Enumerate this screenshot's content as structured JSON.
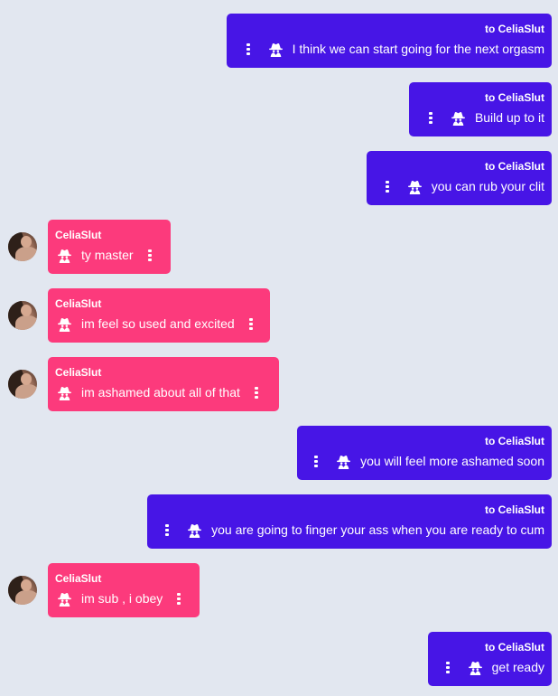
{
  "conversation": {
    "partner": "CeliaSlut",
    "messages": [
      {
        "direction": "outgoing",
        "meta": "to CeliaSlut",
        "text": "I think we can start going for the next orgasm"
      },
      {
        "direction": "outgoing",
        "meta": "to CeliaSlut",
        "text": "Build up to it"
      },
      {
        "direction": "outgoing",
        "meta": "to CeliaSlut",
        "text": "you can rub your clit"
      },
      {
        "direction": "incoming",
        "meta": "CeliaSlut",
        "text": "ty master"
      },
      {
        "direction": "incoming",
        "meta": "CeliaSlut",
        "text": "im feel so used and excited"
      },
      {
        "direction": "incoming",
        "meta": "CeliaSlut",
        "text": "im ashamed about all of that"
      },
      {
        "direction": "outgoing",
        "meta": "to CeliaSlut",
        "text": "you will feel more ashamed soon"
      },
      {
        "direction": "outgoing",
        "meta": "to CeliaSlut",
        "text": "you are going to finger your ass when you are ready to cum"
      },
      {
        "direction": "incoming",
        "meta": "CeliaSlut",
        "text": "im sub , i obey"
      },
      {
        "direction": "outgoing",
        "meta": "to CeliaSlut",
        "text": "get ready"
      }
    ]
  },
  "colors": {
    "background": "#e2e7f0",
    "outgoing_bubble": "#4715e6",
    "incoming_bubble": "#fc3a7c",
    "text": "#ffffff"
  },
  "icons": {
    "private_message": "spy-icon",
    "options": "more-vertical-icon"
  }
}
